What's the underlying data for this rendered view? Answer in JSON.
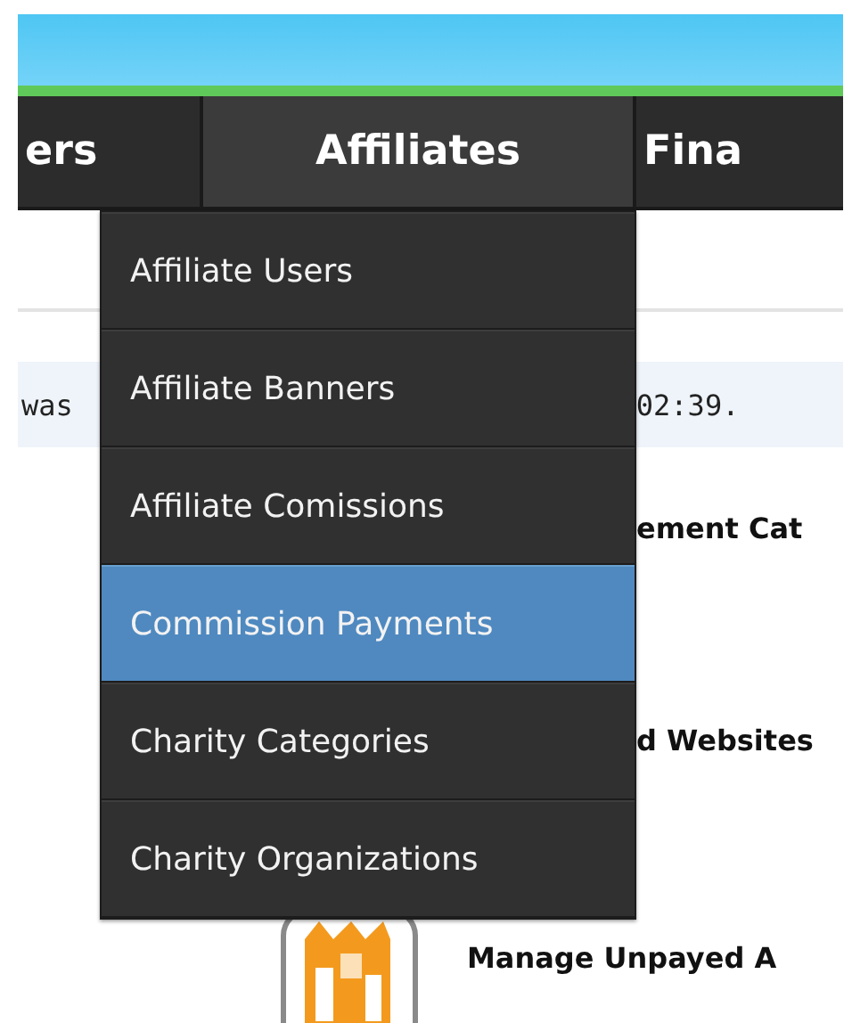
{
  "nav": {
    "tabs": [
      {
        "label": "ers",
        "selected": false
      },
      {
        "label": "Affiliates",
        "selected": true
      },
      {
        "label": "Fina",
        "selected": false
      }
    ]
  },
  "dropdown": {
    "items": [
      {
        "label": "Affiliate Users",
        "selected": false
      },
      {
        "label": "Affiliate Banners",
        "selected": false
      },
      {
        "label": "Affiliate Comissions",
        "selected": false
      },
      {
        "label": "Commission Payments",
        "selected": true
      },
      {
        "label": "Charity Categories",
        "selected": false
      },
      {
        "label": "Charity Organizations",
        "selected": false
      }
    ]
  },
  "notice": {
    "left": "was",
    "right": "02:39."
  },
  "sections": [
    {
      "label": "ement Cat",
      "kind": "text"
    },
    {
      "label": "d Websites",
      "kind": "text"
    },
    {
      "label": "Manage Unpayed A",
      "kind": "icon"
    }
  ]
}
